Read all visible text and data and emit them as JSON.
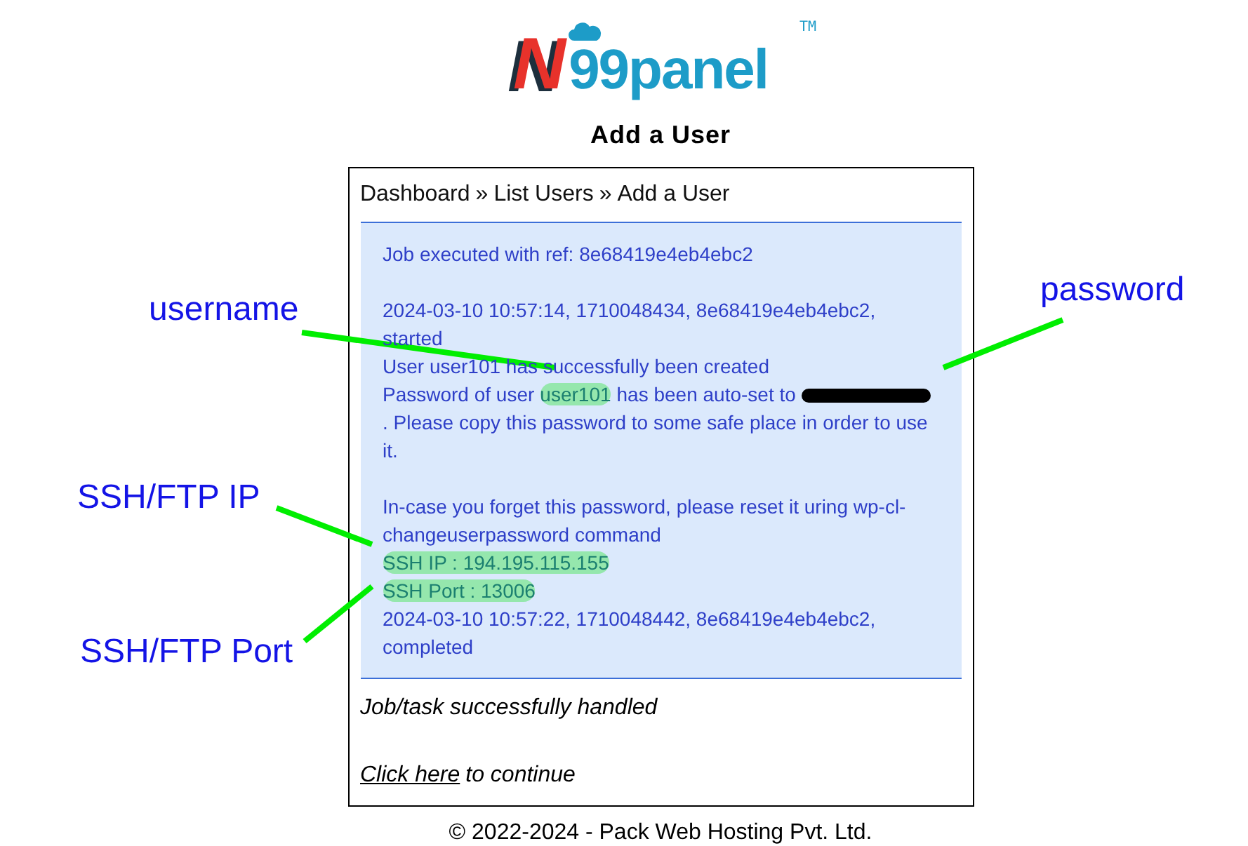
{
  "logo": {
    "mark": "N",
    "name": "99panel",
    "trademark": "TM"
  },
  "title": "Add a User",
  "breadcrumb": [
    {
      "label": "Dashboard",
      "separator": "»"
    },
    {
      "label": "List Users",
      "separator": "»"
    },
    {
      "label": "Add a User"
    }
  ],
  "log": [
    [
      {
        "parts": [
          {
            "text": "Job executed with ref: 8e68419e4eb4ebc2",
            "highlighted": false
          }
        ]
      }
    ],
    [
      {
        "parts": [
          {
            "text": "2024-03-10 10:57:14, 1710048434, 8e68419e4eb4ebc2, started",
            "highlighted": false
          }
        ]
      },
      {
        "parts": [
          {
            "text": "User user101 has successfully been created",
            "highlighted": false
          }
        ]
      },
      {
        "parts": [
          {
            "text": "Password of user",
            "highlighted": false
          },
          {
            "text": "user101",
            "highlighted": true
          },
          {
            "text": "has been auto-set to",
            "highlighted": false
          }
        ],
        "redacted": true,
        "after": ". Please copy this password to some safe place in order to use it."
      }
    ],
    [
      {
        "parts": [
          {
            "text": "In-case you forget this password, please reset it uring wp-cl-changeuserpassword command",
            "highlighted": false
          }
        ]
      },
      {
        "parts": [
          {
            "text": "SSH IP : 194.195.115.155",
            "highlighted": true
          }
        ]
      },
      {
        "parts": [
          {
            "text": "SSH Port : 13006",
            "highlighted": true
          }
        ]
      },
      {
        "parts": [
          {
            "text": "2024-03-10 10:57:22, 1710048442, 8e68419e4eb4ebc2, completed",
            "highlighted": false
          }
        ]
      }
    ]
  ],
  "result": "Job/task successfully handled",
  "continue": {
    "link": "Click here",
    "rest": "to continue"
  },
  "footer": "© 2022-2024 - Pack Web Hosting Pvt. Ltd.",
  "annotations": [
    {
      "label": "username"
    },
    {
      "label": "password"
    },
    {
      "label": "SSH/FTP IP"
    },
    {
      "label": "SSH/FTP Port"
    }
  ]
}
